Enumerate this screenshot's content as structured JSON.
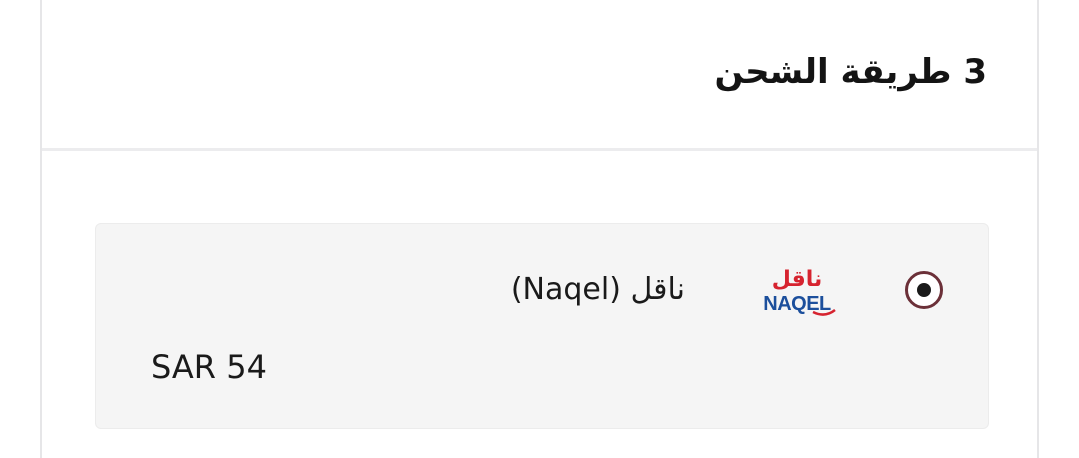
{
  "shipping": {
    "section_title": "3 طريقة الشحن",
    "option": {
      "carrier_name": "(Naqel) ناقل",
      "logo_arabic": "ناقل",
      "logo_latin": "NAQEL",
      "price": "SAR 54",
      "selected": true
    }
  },
  "colors": {
    "radio_ring": "#6b3038",
    "logo_red": "#d6232f",
    "logo_blue": "#1c4f9c",
    "option_bg": "#f5f5f5"
  },
  "icons": {
    "radio": "radio-selected-icon",
    "logo": "naqel-logo"
  }
}
